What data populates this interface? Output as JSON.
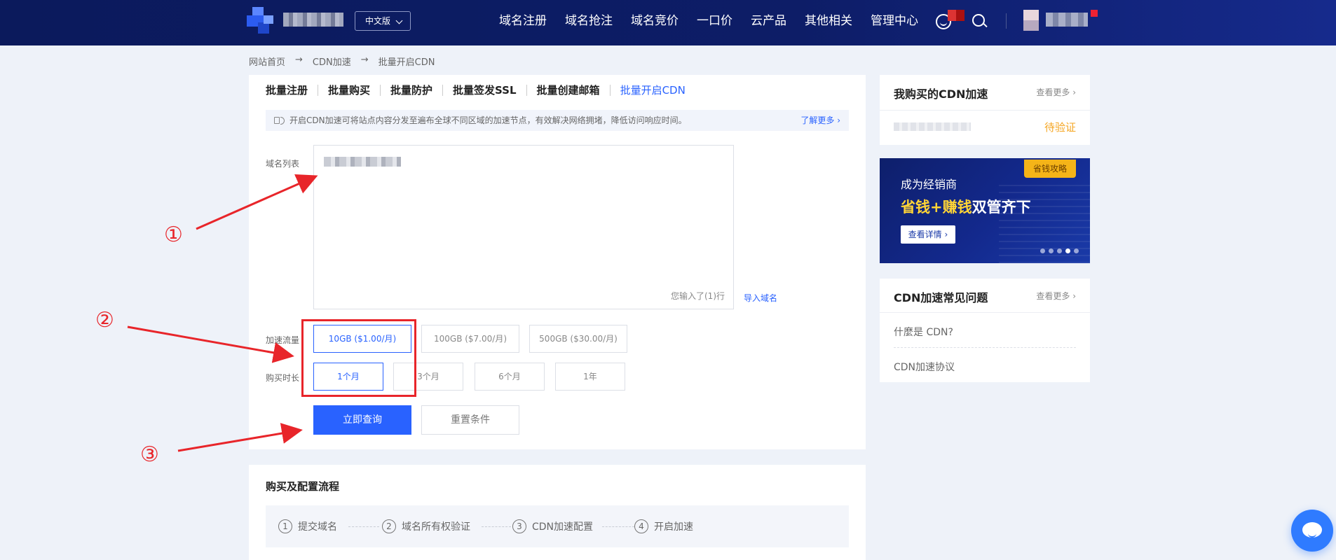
{
  "header": {
    "lang": "中文版",
    "nav": [
      "域名注册",
      "域名抢注",
      "域名竞价",
      "一口价",
      "云产品",
      "其他相关",
      "管理中心"
    ]
  },
  "breadcrumb": [
    "网站首页",
    "CDN加速",
    "批量开启CDN"
  ],
  "tabs": [
    "批量注册",
    "批量购买",
    "批量防护",
    "批量签发SSL",
    "批量创建邮箱",
    "批量开启CDN"
  ],
  "notice": {
    "text": "开启CDN加速可将站点内容分发至遍布全球不同区域的加速节点，有效解决网络拥堵，降低访问响应时间。",
    "link": "了解更多"
  },
  "form": {
    "domain_label": "域名列表",
    "line_count": "您输入了(1)行",
    "import_link": "导入域名",
    "traffic_label": "加速流量",
    "traffic_options": [
      "10GB ($1.00/月)",
      "100GB ($7.00/月)",
      "500GB ($30.00/月)"
    ],
    "duration_label": "购买时长",
    "duration_options": [
      "1个月",
      "3个月",
      "6个月",
      "1年"
    ],
    "query_button": "立即查询",
    "reset_button": "重置条件"
  },
  "process": {
    "title": "购买及配置流程",
    "steps": [
      {
        "num": "1",
        "label": "提交域名"
      },
      {
        "num": "2",
        "label": "域名所有权验证"
      },
      {
        "num": "3",
        "label": "CDN加速配置"
      },
      {
        "num": "4",
        "label": "开启加速"
      }
    ]
  },
  "sidebar": {
    "my_cdn": {
      "title": "我购买的CDN加速",
      "more": "查看更多",
      "status": "待验证"
    },
    "banner": {
      "tag": "省钱攻略",
      "line1": "成为经销商",
      "hl1": "省钱",
      "plus": "+",
      "hl2": "赚钱",
      "rest": "双管齐下",
      "button": "查看详情"
    },
    "faq": {
      "title": "CDN加速常见问题",
      "more": "查看更多",
      "items": [
        "什麼是 CDN?",
        "CDN加速协议"
      ]
    }
  },
  "annotations": [
    "①",
    "②",
    "③"
  ],
  "colors": {
    "accent": "#2962ff",
    "header": "#0d1d67",
    "warning": "#f5a623",
    "annotation": "#e8252a"
  }
}
